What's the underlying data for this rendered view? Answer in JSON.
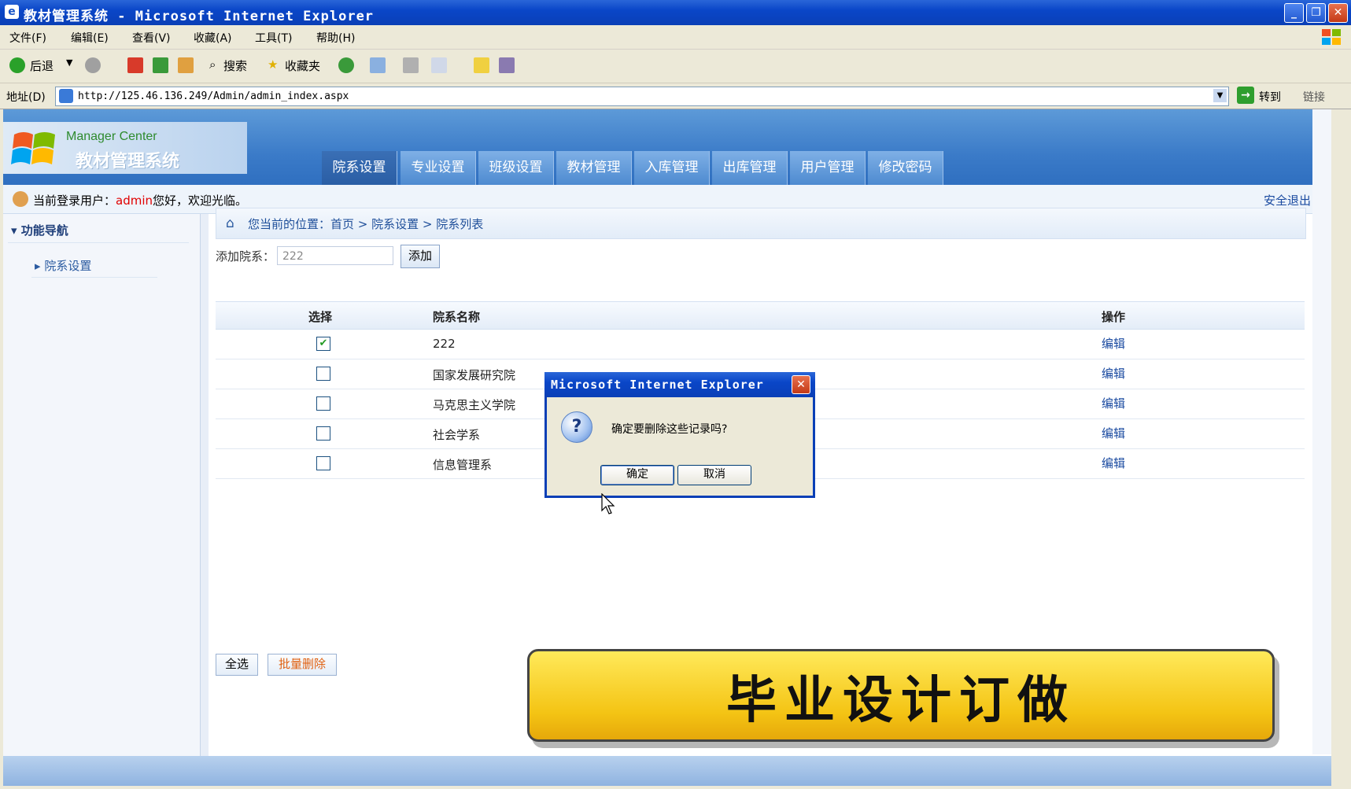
{
  "window": {
    "title": "教材管理系统 - Microsoft Internet Explorer",
    "min": "_",
    "max": "❐",
    "close": "✕"
  },
  "menu": [
    "文件(F)",
    "编辑(E)",
    "查看(V)",
    "收藏(A)",
    "工具(T)",
    "帮助(H)"
  ],
  "toolbar": {
    "back": "后退",
    "search": "搜索",
    "favorites": "收藏夹"
  },
  "address": {
    "label": "地址(D)",
    "url": "http://125.46.136.249/Admin/admin_index.aspx",
    "go": "转到",
    "links": "链接"
  },
  "site": {
    "logo_en": "Manager Center",
    "logo_cn": "教材管理系统",
    "tabs": [
      "院系设置",
      "专业设置",
      "班级设置",
      "教材管理",
      "入库管理",
      "出库管理",
      "用户管理",
      "修改密码"
    ],
    "user_prefix": "当前登录用户：",
    "user_name": "admin",
    "user_suffix": "您好，欢迎光临。",
    "logout": "安全退出",
    "nav_head": "功能导航",
    "nav_item": "院系设置",
    "breadcrumb": "您当前的位置：首页 > 院系设置 > 院系列表",
    "add_label": "添加院系：",
    "add_value": "222",
    "add_button": "添加",
    "table": {
      "headers": [
        "选择",
        "院系名称",
        "操作"
      ],
      "rows": [
        {
          "name": "222",
          "checked": true,
          "action": "编辑"
        },
        {
          "name": "国家发展研究院",
          "checked": false,
          "action": "编辑"
        },
        {
          "name": "马克思主义学院",
          "checked": false,
          "action": "编辑"
        },
        {
          "name": "社会学系",
          "checked": false,
          "action": "编辑"
        },
        {
          "name": "信息管理系",
          "checked": false,
          "action": "编辑"
        }
      ]
    },
    "select_all": "全选",
    "batch_delete": "批量删除"
  },
  "dialog": {
    "title": "Microsoft Internet Explorer",
    "message": "确定要删除这些记录吗?",
    "ok": "确定",
    "cancel": "取消"
  },
  "banner": "毕业设计订做",
  "colors": {
    "titlebar": "#0a46c8",
    "header": "#3b7bc8",
    "username": "#e00000",
    "banner": "#f4c414"
  }
}
